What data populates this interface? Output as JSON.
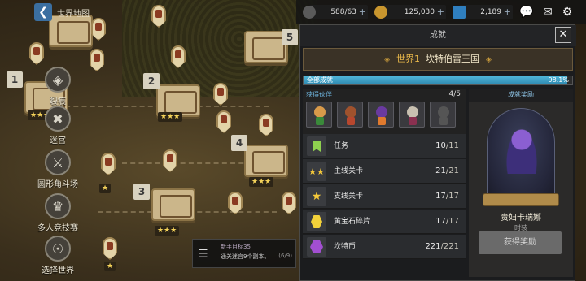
{
  "topbar": {
    "back_title": "世界地图",
    "stamina": "588/63",
    "gold": "125,030",
    "gems": "2,189",
    "chat_icon": "chat-icon",
    "mail_icon": "mail-icon",
    "settings_icon": "gear-icon"
  },
  "map": {
    "stage_numbers": [
      "1",
      "2",
      "3",
      "4",
      "5"
    ]
  },
  "side_menu": {
    "items": [
      {
        "label": "裂痕",
        "icon": "rift-icon"
      },
      {
        "label": "迷宫",
        "icon": "maze-icon"
      },
      {
        "label": "圆形角斗场",
        "icon": "arena-icon"
      },
      {
        "label": "多人竞技赛",
        "icon": "pvp-icon"
      },
      {
        "label": "选择世界",
        "icon": "world-icon"
      }
    ]
  },
  "panel": {
    "title": "成就",
    "world_prefix": "世界1",
    "world_name": "坎特伯雷王国",
    "progress_label": "全部成就",
    "progress_pct": "98.1%",
    "progress_value": 0.981,
    "companions_label": "获得伙伴",
    "companions_count": "4/5",
    "rows": [
      {
        "label": "任务",
        "current": "10",
        "total": "/11",
        "icon": "bookmark-icon"
      },
      {
        "label": "主线关卡",
        "current": "21",
        "total": "/21",
        "icon": "triple-star-icon"
      },
      {
        "label": "支线关卡",
        "current": "17",
        "total": "/17",
        "icon": "star-icon"
      },
      {
        "label": "黄宝石碎片",
        "current": "17",
        "total": "/17",
        "icon": "gem-fragment-icon"
      },
      {
        "label": "坎特币",
        "current": "221",
        "total": "/221",
        "icon": "coin-icon"
      }
    ],
    "reward_header": "成就奖励",
    "reward_name": "贵妇卡瑞娜",
    "reward_type": "时装",
    "claim_label": "获得奖励"
  },
  "mission": {
    "title": "新手目标35",
    "desc": "通关迷宫9个副本。",
    "progress": "(6/9)"
  },
  "colors": {
    "accent": "#4fb6d8",
    "gold": "#e6b64a",
    "panel_bg": "#1b1c1e"
  }
}
